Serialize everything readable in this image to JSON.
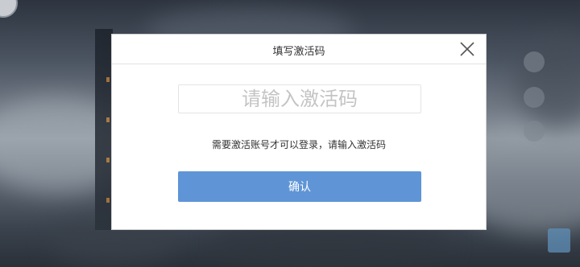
{
  "dialog": {
    "title": "填写激活码",
    "close_icon": "close-icon",
    "input_placeholder": "请输入激活码",
    "input_value": "",
    "hint": "需要激活账号才可以登录，请输入激活码",
    "confirm_label": "确认"
  },
  "colors": {
    "confirm_button": "#5f95d6",
    "dialog_background": "#ffffff",
    "backdrop": "#4a5360"
  }
}
